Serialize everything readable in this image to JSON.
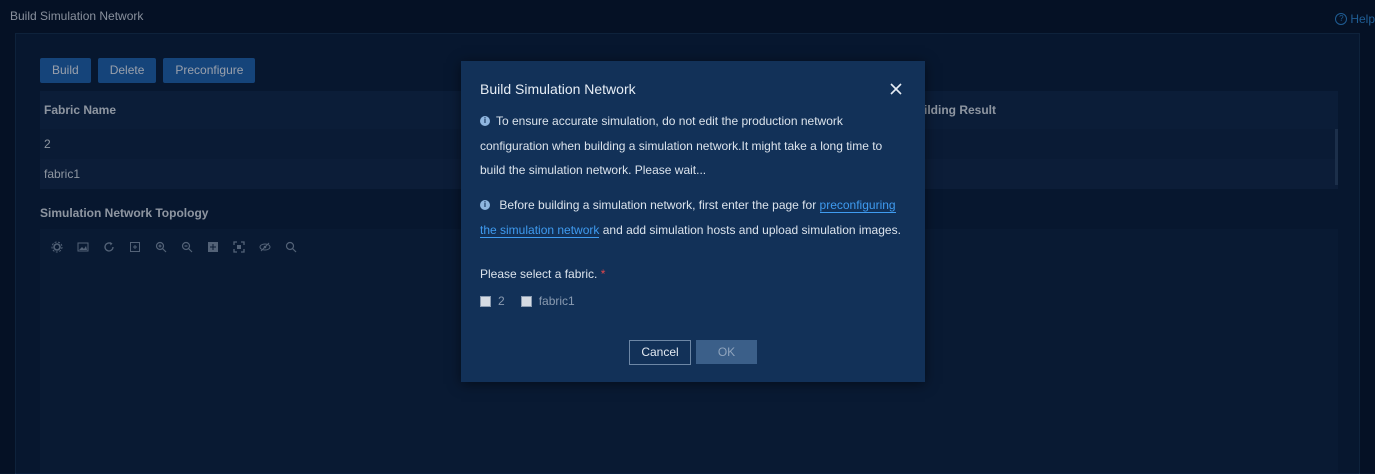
{
  "page": {
    "title": "Build Simulation Network",
    "help_label": "Help"
  },
  "toolbar": {
    "build_label": "Build",
    "delete_label": "Delete",
    "preconfigure_label": "Preconfigure"
  },
  "table": {
    "columns": [
      "Fabric Name",
      "ilding Result"
    ],
    "rows": [
      {
        "fabric_name": "2"
      },
      {
        "fabric_name": "fabric1"
      }
    ]
  },
  "topology": {
    "title": "Simulation Network Topology",
    "tools": [
      "settings-icon",
      "image-icon",
      "refresh-icon",
      "fit-icon",
      "zoom-in-icon",
      "zoom-out-icon",
      "layout-icon",
      "fullscreen-icon",
      "hide-icon",
      "search-icon"
    ]
  },
  "modal": {
    "title": "Build Simulation Network",
    "info1": "To ensure accurate simulation, do not edit the production network configuration when building a simulation network.It might take a long time to build the simulation network. Please wait...",
    "info2_before": "Before building a simulation network, first enter the page for ",
    "info2_link": "preconfiguring the simulation network",
    "info2_after": " and add simulation hosts and upload simulation images.",
    "fabric_label": "Please select a fabric.",
    "required_mark": "*",
    "options": [
      "2",
      "fabric1"
    ],
    "cancel_label": "Cancel",
    "ok_label": "OK"
  }
}
